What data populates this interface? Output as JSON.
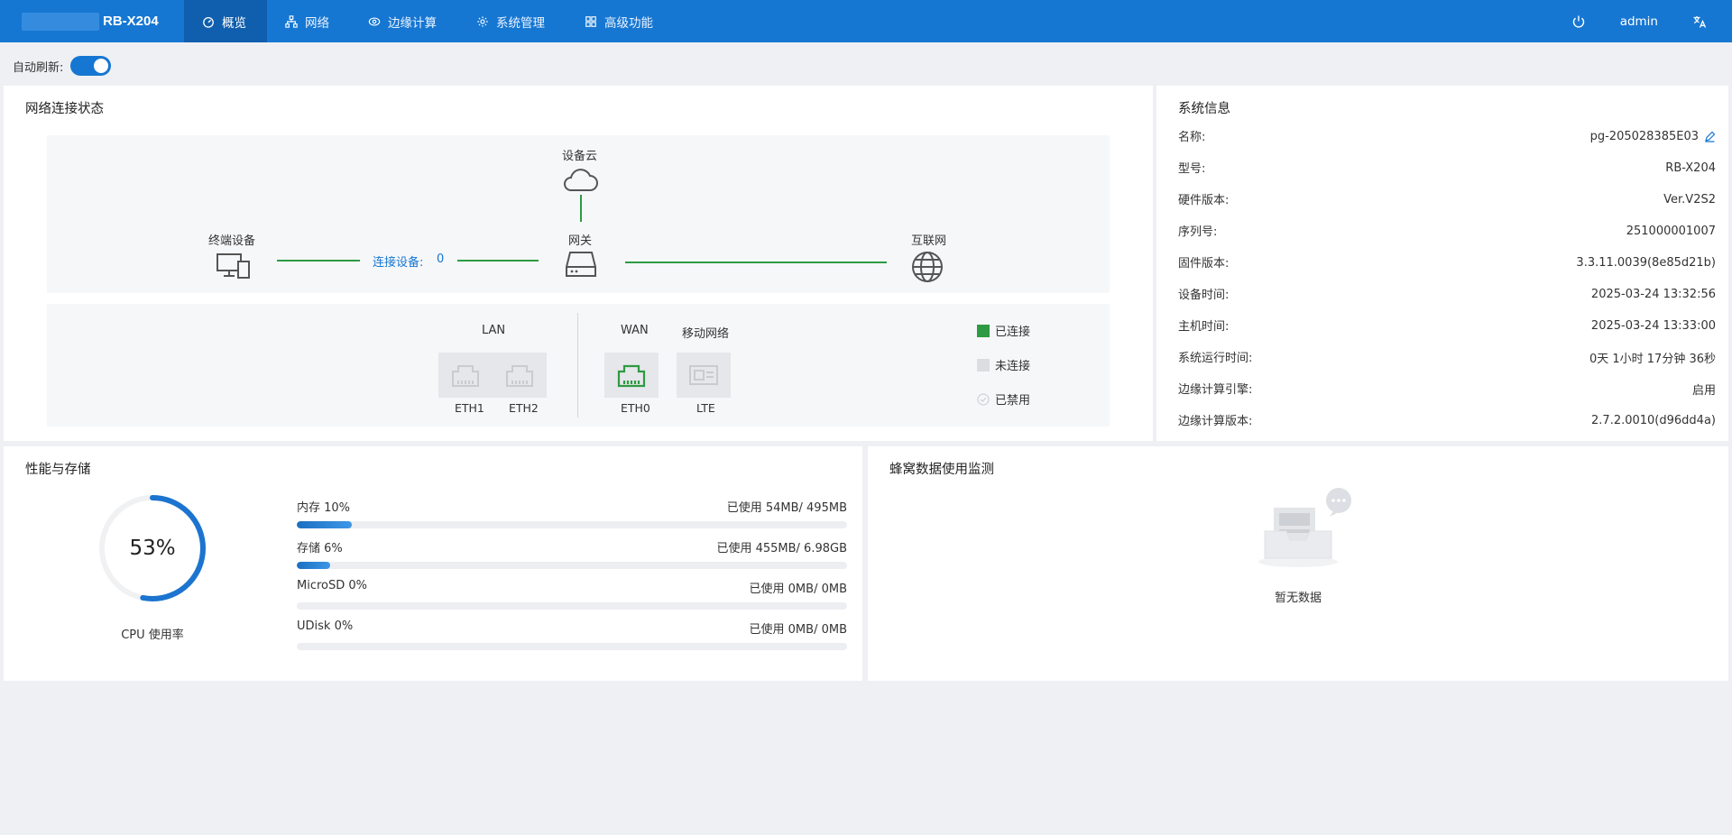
{
  "header": {
    "device_model": "RB-X204",
    "nav": [
      {
        "label": "概览",
        "icon": "dashboard-icon"
      },
      {
        "label": "网络",
        "icon": "network-icon"
      },
      {
        "label": "边缘计算",
        "icon": "edge-icon"
      },
      {
        "label": "系统管理",
        "icon": "gear-icon"
      },
      {
        "label": "高级功能",
        "icon": "grid-icon"
      }
    ],
    "user": "admin",
    "accent_color": "#1677d2"
  },
  "auto_refresh": {
    "label": "自动刷新:",
    "enabled": true
  },
  "network_status": {
    "title": "网络连接状态",
    "cloud_label": "设备云",
    "terminal_label": "终端设备",
    "gateway_label": "网关",
    "internet_label": "互联网",
    "connected_devices_label": "连接设备:",
    "connected_devices_count": "0",
    "lan_label": "LAN",
    "wan_label": "WAN",
    "mobile_label": "移动网络",
    "ports": {
      "eth1": {
        "name": "ETH1",
        "status": "disconnected"
      },
      "eth2": {
        "name": "ETH2",
        "status": "disconnected"
      },
      "eth0": {
        "name": "ETH0",
        "status": "connected"
      },
      "lte": {
        "name": "LTE",
        "status": "disconnected"
      }
    },
    "legend": {
      "connected": "已连接",
      "disconnected": "未连接",
      "disabled": "已禁用"
    },
    "status_colors": {
      "connected": "#2e9a43",
      "disconnected": "#dcdde0"
    }
  },
  "system_info": {
    "title": "系统信息",
    "rows": [
      {
        "key": "名称:",
        "value": "pg-205028385E03"
      },
      {
        "key": "型号:",
        "value": "RB-X204"
      },
      {
        "key": "硬件版本:",
        "value": "Ver.V2S2"
      },
      {
        "key": "序列号:",
        "value": "251000001007"
      },
      {
        "key": "固件版本:",
        "value": "3.3.11.0039(8e85d21b)"
      },
      {
        "key": "设备时间:",
        "value": "2025-03-24 13:32:56"
      },
      {
        "key": "主机时间:",
        "value": "2025-03-24 13:33:00"
      },
      {
        "key": "系统运行时间:",
        "value": "0天 1小时 17分钟 36秒"
      },
      {
        "key": "边缘计算引擎:",
        "value": "启用"
      },
      {
        "key": "边缘计算版本:",
        "value": "2.7.2.0010(d96dd4a)"
      }
    ]
  },
  "performance": {
    "title": "性能与存储",
    "cpu_label": "CPU 使用率",
    "cpu_text": "53%",
    "cpu_fraction": 0.53,
    "storage": [
      {
        "label": "内存 10%",
        "usage": "已使用 54MB/ 495MB",
        "fraction": 0.1
      },
      {
        "label": "存储 6%",
        "usage": "已使用 455MB/ 6.98GB",
        "fraction": 0.06
      },
      {
        "label": "MicroSD 0%",
        "usage": "已使用 0MB/ 0MB",
        "fraction": 0
      },
      {
        "label": "UDisk 0%",
        "usage": "已使用 0MB/ 0MB",
        "fraction": 0
      }
    ]
  },
  "cellular": {
    "title": "蜂窝数据使用监测",
    "empty_text": "暂无数据"
  }
}
